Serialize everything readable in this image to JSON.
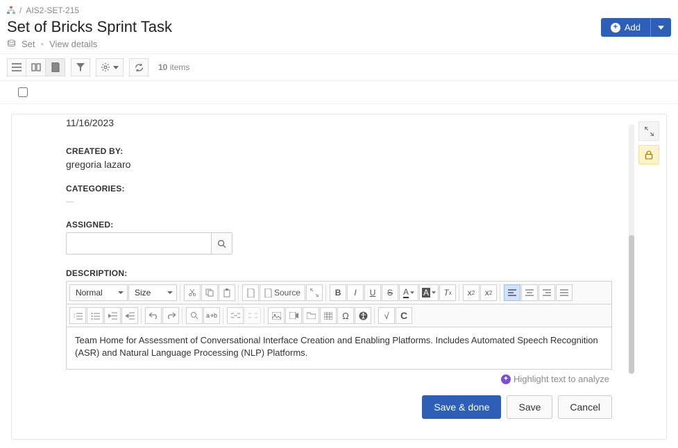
{
  "breadcrumb": {
    "item_id": "AIS2-SET-215"
  },
  "header": {
    "title": "Set of Bricks Sprint Task",
    "type_label": "Set",
    "view_details": "View details",
    "add_label": "Add"
  },
  "toolbar": {
    "count_number": "10",
    "count_label": "items"
  },
  "form": {
    "date_value": "11/16/2023",
    "created_by_label": "CREATED BY:",
    "created_by_value": "gregoria lazaro",
    "categories_label": "CATEGORIES:",
    "categories_value": "—",
    "assigned_label": "ASSIGNED:",
    "description_label": "DESCRIPTION:",
    "description_value": "Team Home for Assessment of Conversational Interface Creation and Enabling Platforms. Includes Automated Speech Recognition (ASR) and Natural Language Processing (NLP) Platforms."
  },
  "editor": {
    "format_select": "Normal",
    "size_select": "Size",
    "source_label": "Source"
  },
  "highlight_hint": "Highlight text to analyze",
  "buttons": {
    "save_done": "Save & done",
    "save": "Save",
    "cancel": "Cancel"
  }
}
